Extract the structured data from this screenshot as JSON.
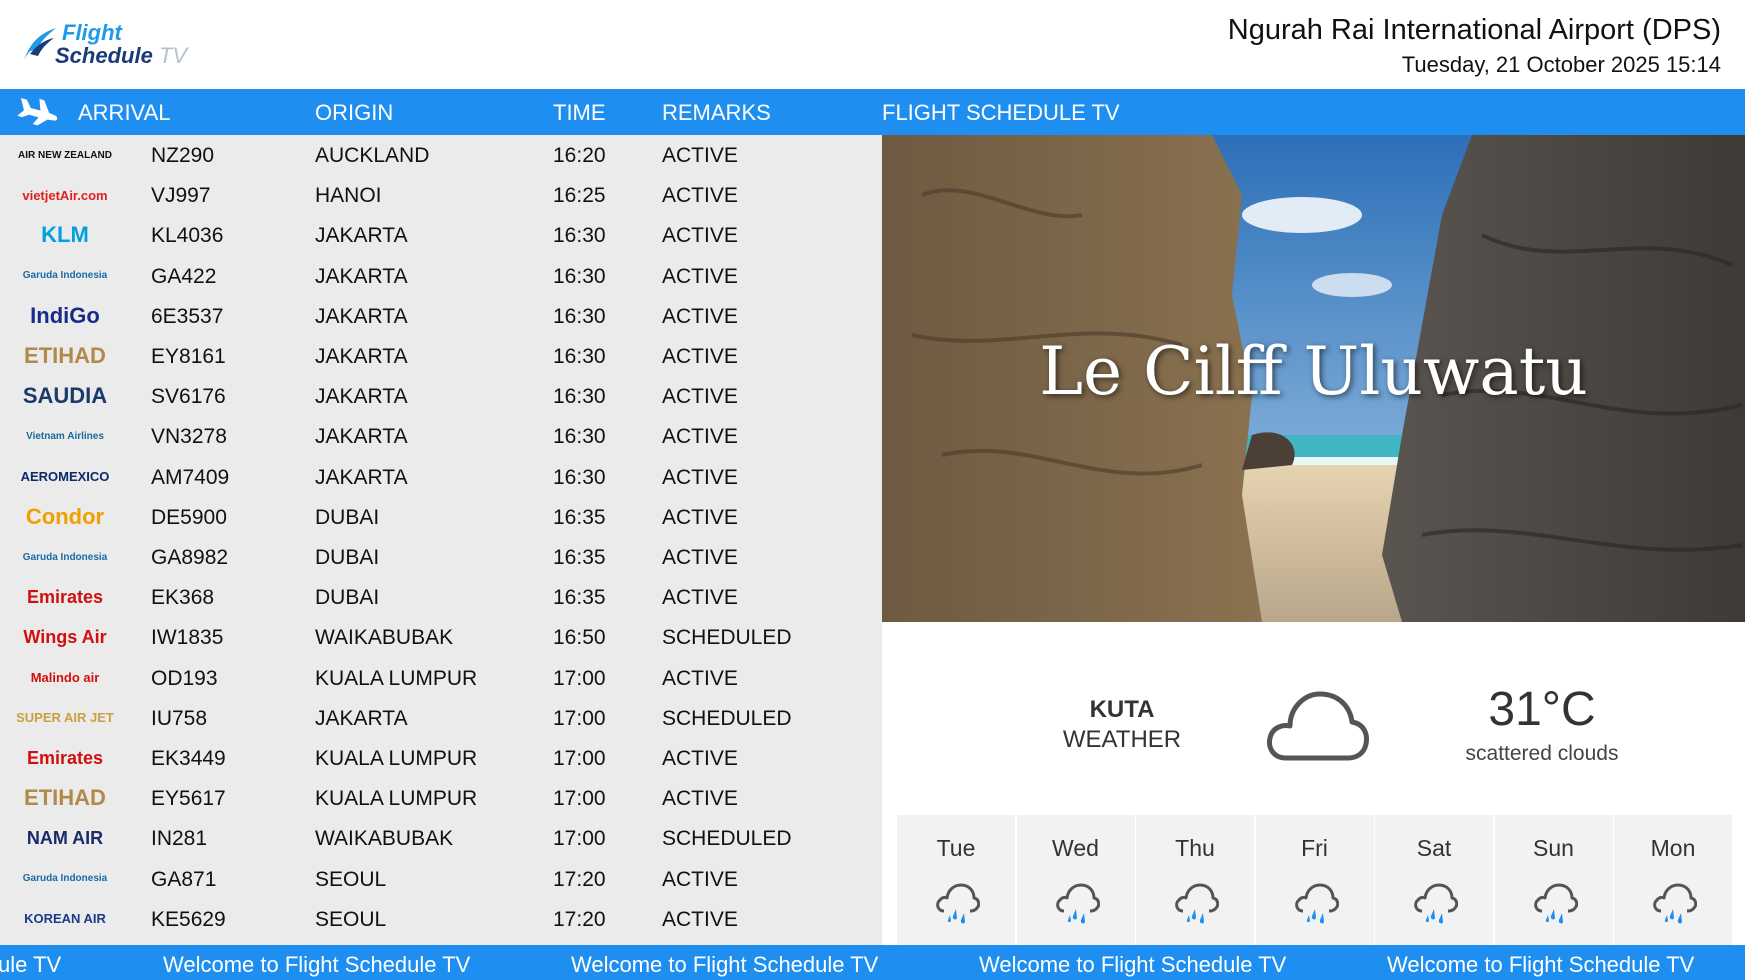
{
  "header": {
    "logo_line1": "Flight",
    "logo_line2": "Schedule",
    "logo_tv": "TV",
    "airport": "Ngurah Rai International Airport (DPS)",
    "datetime": "Tuesday, 21 October 2025 15:14"
  },
  "bar": {
    "arrival": "ARRIVAL",
    "origin": "ORIGIN",
    "time": "TIME",
    "remarks": "REMARKS",
    "panel_title": "FLIGHT SCHEDULE TV"
  },
  "flights": [
    {
      "airline": "AIR NEW ZEALAND",
      "logo_color": "#111111",
      "code": "NZ290",
      "origin": "AUCKLAND",
      "time": "16:20",
      "remarks": "ACTIVE"
    },
    {
      "airline": "vietjetAir.com",
      "logo_color": "#e02020",
      "code": "VJ997",
      "origin": "HANOI",
      "time": "16:25",
      "remarks": "ACTIVE"
    },
    {
      "airline": "KLM",
      "logo_color": "#00a1de",
      "code": "KL4036",
      "origin": "JAKARTA",
      "time": "16:30",
      "remarks": "ACTIVE"
    },
    {
      "airline": "Garuda Indonesia",
      "logo_color": "#1a6aa5",
      "code": "GA422",
      "origin": "JAKARTA",
      "time": "16:30",
      "remarks": "ACTIVE"
    },
    {
      "airline": "IndiGo",
      "logo_color": "#1a2a8a",
      "code": "6E3537",
      "origin": "JAKARTA",
      "time": "16:30",
      "remarks": "ACTIVE"
    },
    {
      "airline": "ETIHAD",
      "logo_color": "#b08a4a",
      "code": "EY8161",
      "origin": "JAKARTA",
      "time": "16:30",
      "remarks": "ACTIVE"
    },
    {
      "airline": "SAUDIA",
      "logo_color": "#1a3a6a",
      "code": "SV6176",
      "origin": "JAKARTA",
      "time": "16:30",
      "remarks": "ACTIVE"
    },
    {
      "airline": "Vietnam Airlines",
      "logo_color": "#1a6a9a",
      "code": "VN3278",
      "origin": "JAKARTA",
      "time": "16:30",
      "remarks": "ACTIVE"
    },
    {
      "airline": "AEROMEXICO",
      "logo_color": "#0b2a6a",
      "code": "AM7409",
      "origin": "JAKARTA",
      "time": "16:30",
      "remarks": "ACTIVE"
    },
    {
      "airline": "Condor",
      "logo_color": "#f0a000",
      "code": "DE5900",
      "origin": "DUBAI",
      "time": "16:35",
      "remarks": "ACTIVE"
    },
    {
      "airline": "Garuda Indonesia",
      "logo_color": "#1a6aa5",
      "code": "GA8982",
      "origin": "DUBAI",
      "time": "16:35",
      "remarks": "ACTIVE"
    },
    {
      "airline": "Emirates",
      "logo_color": "#d01010",
      "code": "EK368",
      "origin": "DUBAI",
      "time": "16:35",
      "remarks": "ACTIVE"
    },
    {
      "airline": "Wings Air",
      "logo_color": "#d01010",
      "code": "IW1835",
      "origin": "WAIKABUBAK",
      "time": "16:50",
      "remarks": "SCHEDULED"
    },
    {
      "airline": "Malindo air",
      "logo_color": "#d01010",
      "code": "OD193",
      "origin": "KUALA LUMPUR",
      "time": "17:00",
      "remarks": "ACTIVE"
    },
    {
      "airline": "SUPER AIR JET",
      "logo_color": "#c8a040",
      "code": "IU758",
      "origin": "JAKARTA",
      "time": "17:00",
      "remarks": "SCHEDULED"
    },
    {
      "airline": "Emirates",
      "logo_color": "#d01010",
      "code": "EK3449",
      "origin": "KUALA LUMPUR",
      "time": "17:00",
      "remarks": "ACTIVE"
    },
    {
      "airline": "ETIHAD",
      "logo_color": "#b08a4a",
      "code": "EY5617",
      "origin": "KUALA LUMPUR",
      "time": "17:00",
      "remarks": "ACTIVE"
    },
    {
      "airline": "NAM AIR",
      "logo_color": "#1a2a6a",
      "code": "IN281",
      "origin": "WAIKABUBAK",
      "time": "17:00",
      "remarks": "SCHEDULED"
    },
    {
      "airline": "Garuda Indonesia",
      "logo_color": "#1a6aa5",
      "code": "GA871",
      "origin": "SEOUL",
      "time": "17:20",
      "remarks": "ACTIVE"
    },
    {
      "airline": "KOREAN AIR",
      "logo_color": "#1a3a8a",
      "code": "KE5629",
      "origin": "SEOUL",
      "time": "17:20",
      "remarks": "ACTIVE"
    }
  ],
  "photo": {
    "title": "Le Cilff Uluwatu"
  },
  "weather": {
    "city": "KUTA",
    "label": "WEATHER",
    "temperature": "31°C",
    "description": "scattered clouds",
    "icon": "cloud-icon",
    "forecast": [
      {
        "day": "Tue",
        "icon": "rain-icon"
      },
      {
        "day": "Wed",
        "icon": "rain-icon"
      },
      {
        "day": "Thu",
        "icon": "rain-icon"
      },
      {
        "day": "Fri",
        "icon": "rain-icon"
      },
      {
        "day": "Sat",
        "icon": "rain-icon"
      },
      {
        "day": "Sun",
        "icon": "rain-icon"
      },
      {
        "day": "Mon",
        "icon": "rain-icon"
      }
    ]
  },
  "ticker": {
    "partial": "ule TV",
    "message": "Welcome to Flight Schedule TV"
  },
  "colors": {
    "accent": "#1e8ff0",
    "list_bg": "#ebebeb"
  }
}
